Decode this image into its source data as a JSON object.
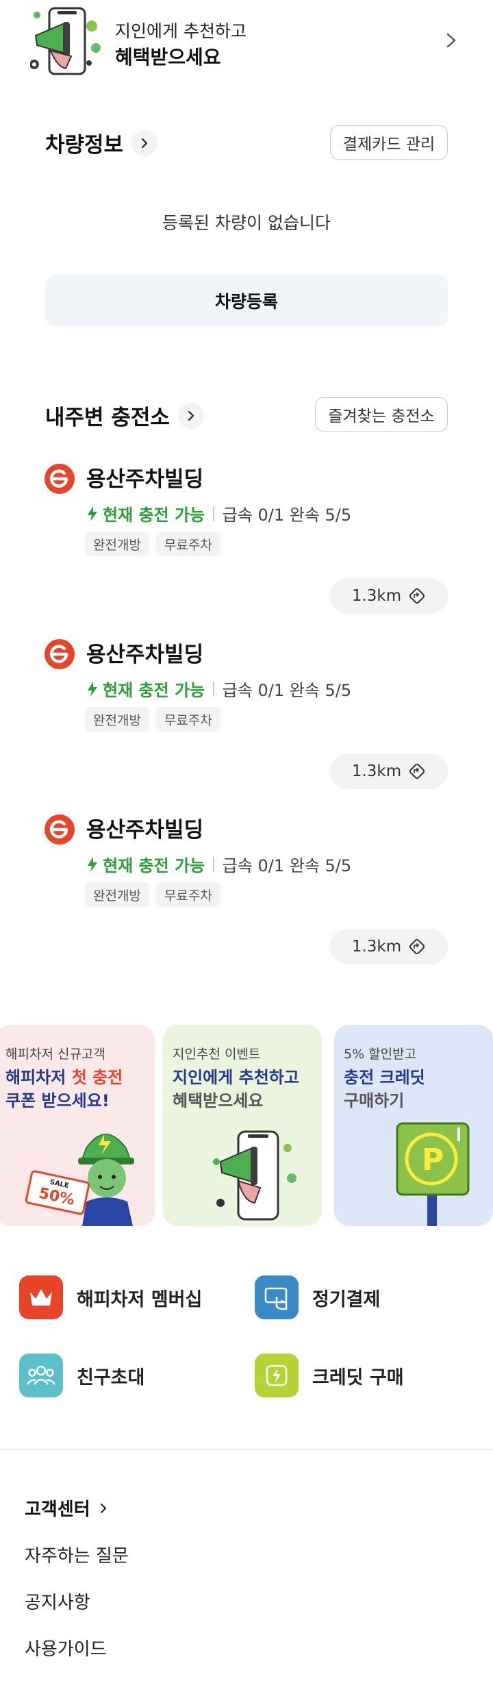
{
  "referral": {
    "subtitle": "지인에게 추천하고",
    "title": "혜택받으세요"
  },
  "vehicle": {
    "title": "차량정보",
    "manage_card_label": "결제카드 관리",
    "empty_message": "등록된 차량이 없습니다",
    "register_label": "차량등록"
  },
  "nearby": {
    "title": "내주변 충전소",
    "favorites_label": "즐겨찾는 충전소",
    "stations": [
      {
        "name": "용산주차빌딩",
        "status": "현재 충전 가능",
        "counts": "급속 0/1  완속 5/5",
        "tags": [
          "완전개방",
          "무료주차"
        ],
        "distance": "1.3km"
      },
      {
        "name": "용산주차빌딩",
        "status": "현재 충전 가능",
        "counts": "급속 0/1  완속 5/5",
        "tags": [
          "완전개방",
          "무료주차"
        ],
        "distance": "1.3km"
      },
      {
        "name": "용산주차빌딩",
        "status": "현재 충전 가능",
        "counts": "급속 0/1  완속 5/5",
        "tags": [
          "완전개방",
          "무료주차"
        ],
        "distance": "1.3km"
      }
    ]
  },
  "promos": [
    {
      "subtitle": "해피차저 신규고객",
      "title_line1_a": "해피차저 ",
      "title_line1_b": "첫 충전",
      "title_line2": "쿠폰 받으세요!",
      "coupon_small": "SALE",
      "coupon_big": "50%",
      "bg": "#fbe9ea"
    },
    {
      "subtitle": "지인추천 이벤트",
      "title_line1": "지인에게 추천하고",
      "title_line2": "혜택받으세요",
      "bg": "#ebf4dc"
    },
    {
      "subtitle": "5% 할인받고",
      "title_line1": "충전 크레딧",
      "title_line2": "구매하기",
      "bg": "#dde6f6"
    }
  ],
  "menu": {
    "membership": "해피차저 멤버십",
    "subscription": "정기결제",
    "invite": "친구초대",
    "credit": "크레딧 구매"
  },
  "footer": {
    "support_title": "고객센터",
    "faq": "자주하는 질문",
    "notice": "공지사항",
    "guide": "사용가이드"
  },
  "colors": {
    "accent_green": "#2d9d3c",
    "brand_red": "#e8442a",
    "promo_blue": "#223a8c"
  }
}
